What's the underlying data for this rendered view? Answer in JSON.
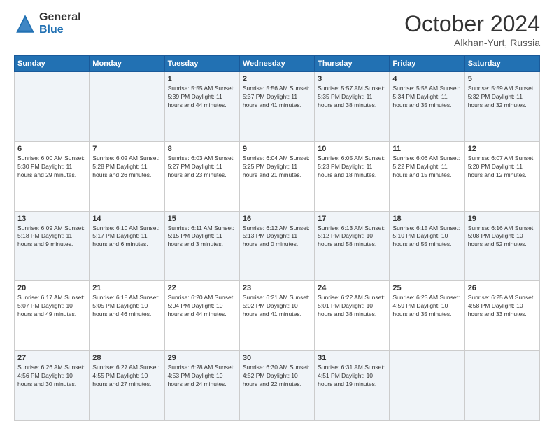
{
  "logo": {
    "general": "General",
    "blue": "Blue"
  },
  "title": "October 2024",
  "subtitle": "Alkhan-Yurt, Russia",
  "days_of_week": [
    "Sunday",
    "Monday",
    "Tuesday",
    "Wednesday",
    "Thursday",
    "Friday",
    "Saturday"
  ],
  "weeks": [
    [
      {
        "day": "",
        "info": ""
      },
      {
        "day": "",
        "info": ""
      },
      {
        "day": "1",
        "info": "Sunrise: 5:55 AM\nSunset: 5:39 PM\nDaylight: 11 hours and 44 minutes."
      },
      {
        "day": "2",
        "info": "Sunrise: 5:56 AM\nSunset: 5:37 PM\nDaylight: 11 hours and 41 minutes."
      },
      {
        "day": "3",
        "info": "Sunrise: 5:57 AM\nSunset: 5:35 PM\nDaylight: 11 hours and 38 minutes."
      },
      {
        "day": "4",
        "info": "Sunrise: 5:58 AM\nSunset: 5:34 PM\nDaylight: 11 hours and 35 minutes."
      },
      {
        "day": "5",
        "info": "Sunrise: 5:59 AM\nSunset: 5:32 PM\nDaylight: 11 hours and 32 minutes."
      }
    ],
    [
      {
        "day": "6",
        "info": "Sunrise: 6:00 AM\nSunset: 5:30 PM\nDaylight: 11 hours and 29 minutes."
      },
      {
        "day": "7",
        "info": "Sunrise: 6:02 AM\nSunset: 5:28 PM\nDaylight: 11 hours and 26 minutes."
      },
      {
        "day": "8",
        "info": "Sunrise: 6:03 AM\nSunset: 5:27 PM\nDaylight: 11 hours and 23 minutes."
      },
      {
        "day": "9",
        "info": "Sunrise: 6:04 AM\nSunset: 5:25 PM\nDaylight: 11 hours and 21 minutes."
      },
      {
        "day": "10",
        "info": "Sunrise: 6:05 AM\nSunset: 5:23 PM\nDaylight: 11 hours and 18 minutes."
      },
      {
        "day": "11",
        "info": "Sunrise: 6:06 AM\nSunset: 5:22 PM\nDaylight: 11 hours and 15 minutes."
      },
      {
        "day": "12",
        "info": "Sunrise: 6:07 AM\nSunset: 5:20 PM\nDaylight: 11 hours and 12 minutes."
      }
    ],
    [
      {
        "day": "13",
        "info": "Sunrise: 6:09 AM\nSunset: 5:18 PM\nDaylight: 11 hours and 9 minutes."
      },
      {
        "day": "14",
        "info": "Sunrise: 6:10 AM\nSunset: 5:17 PM\nDaylight: 11 hours and 6 minutes."
      },
      {
        "day": "15",
        "info": "Sunrise: 6:11 AM\nSunset: 5:15 PM\nDaylight: 11 hours and 3 minutes."
      },
      {
        "day": "16",
        "info": "Sunrise: 6:12 AM\nSunset: 5:13 PM\nDaylight: 11 hours and 0 minutes."
      },
      {
        "day": "17",
        "info": "Sunrise: 6:13 AM\nSunset: 5:12 PM\nDaylight: 10 hours and 58 minutes."
      },
      {
        "day": "18",
        "info": "Sunrise: 6:15 AM\nSunset: 5:10 PM\nDaylight: 10 hours and 55 minutes."
      },
      {
        "day": "19",
        "info": "Sunrise: 6:16 AM\nSunset: 5:08 PM\nDaylight: 10 hours and 52 minutes."
      }
    ],
    [
      {
        "day": "20",
        "info": "Sunrise: 6:17 AM\nSunset: 5:07 PM\nDaylight: 10 hours and 49 minutes."
      },
      {
        "day": "21",
        "info": "Sunrise: 6:18 AM\nSunset: 5:05 PM\nDaylight: 10 hours and 46 minutes."
      },
      {
        "day": "22",
        "info": "Sunrise: 6:20 AM\nSunset: 5:04 PM\nDaylight: 10 hours and 44 minutes."
      },
      {
        "day": "23",
        "info": "Sunrise: 6:21 AM\nSunset: 5:02 PM\nDaylight: 10 hours and 41 minutes."
      },
      {
        "day": "24",
        "info": "Sunrise: 6:22 AM\nSunset: 5:01 PM\nDaylight: 10 hours and 38 minutes."
      },
      {
        "day": "25",
        "info": "Sunrise: 6:23 AM\nSunset: 4:59 PM\nDaylight: 10 hours and 35 minutes."
      },
      {
        "day": "26",
        "info": "Sunrise: 6:25 AM\nSunset: 4:58 PM\nDaylight: 10 hours and 33 minutes."
      }
    ],
    [
      {
        "day": "27",
        "info": "Sunrise: 6:26 AM\nSunset: 4:56 PM\nDaylight: 10 hours and 30 minutes."
      },
      {
        "day": "28",
        "info": "Sunrise: 6:27 AM\nSunset: 4:55 PM\nDaylight: 10 hours and 27 minutes."
      },
      {
        "day": "29",
        "info": "Sunrise: 6:28 AM\nSunset: 4:53 PM\nDaylight: 10 hours and 24 minutes."
      },
      {
        "day": "30",
        "info": "Sunrise: 6:30 AM\nSunset: 4:52 PM\nDaylight: 10 hours and 22 minutes."
      },
      {
        "day": "31",
        "info": "Sunrise: 6:31 AM\nSunset: 4:51 PM\nDaylight: 10 hours and 19 minutes."
      },
      {
        "day": "",
        "info": ""
      },
      {
        "day": "",
        "info": ""
      }
    ]
  ]
}
